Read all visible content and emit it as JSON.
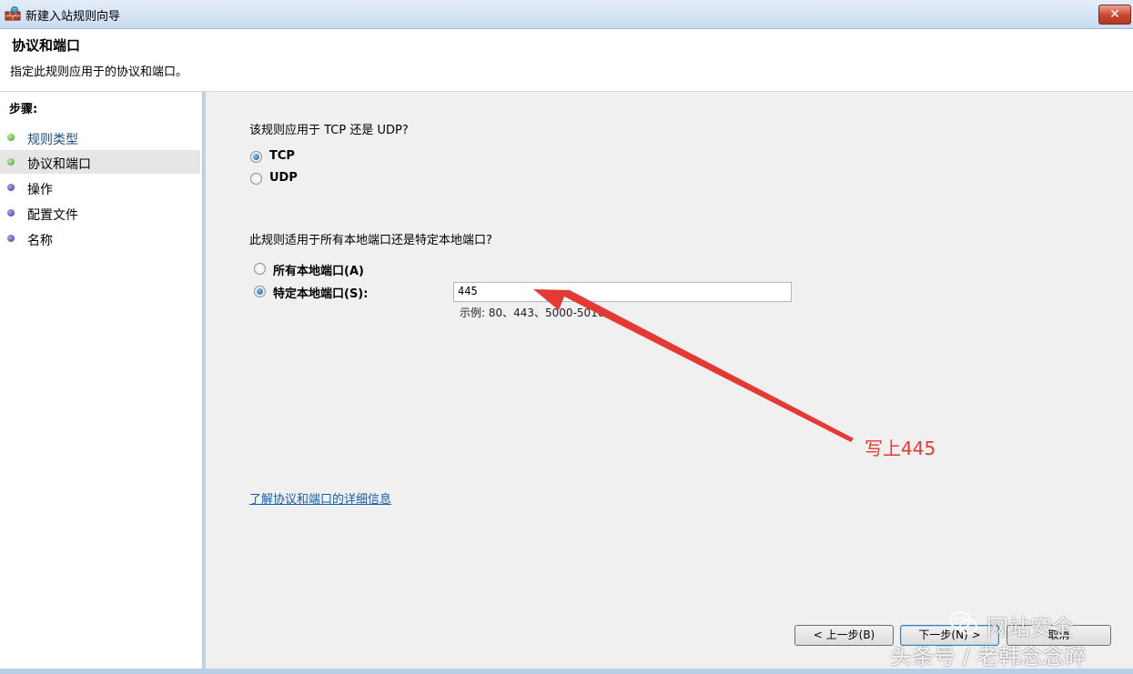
{
  "window": {
    "title": "新建入站规则向导",
    "close_label": "✕"
  },
  "header": {
    "title": "协议和端口",
    "subtitle": "指定此规则应用于的协议和端口。"
  },
  "sidebar": {
    "heading": "步骤:",
    "items": [
      {
        "label": "规则类型",
        "state": "done"
      },
      {
        "label": "协议和端口",
        "state": "current"
      },
      {
        "label": "操作",
        "state": "pending"
      },
      {
        "label": "配置文件",
        "state": "pending"
      },
      {
        "label": "名称",
        "state": "pending"
      }
    ]
  },
  "protocol": {
    "question": "该规则应用于 TCP 还是 UDP?",
    "options": [
      {
        "label": "TCP",
        "selected": true
      },
      {
        "label": "UDP",
        "selected": false
      }
    ]
  },
  "ports": {
    "question": "此规则适用于所有本地端口还是特定本地端口?",
    "options": [
      {
        "label": "所有本地端口(A)",
        "selected": false
      },
      {
        "label": "特定本地端口(S):",
        "selected": true
      }
    ],
    "value": "445",
    "example": "示例: 80、443、5000-5010"
  },
  "help_link": "了解协议和端口的详细信息",
  "buttons": {
    "back": "< 上一步(B)",
    "next": "下一步(N) >",
    "cancel": "取消"
  },
  "annotation": {
    "text": "写上445",
    "color": "#e53a33"
  },
  "watermark": {
    "line1": "网站安全",
    "line2": "头条号 / 老韩念念碎"
  }
}
